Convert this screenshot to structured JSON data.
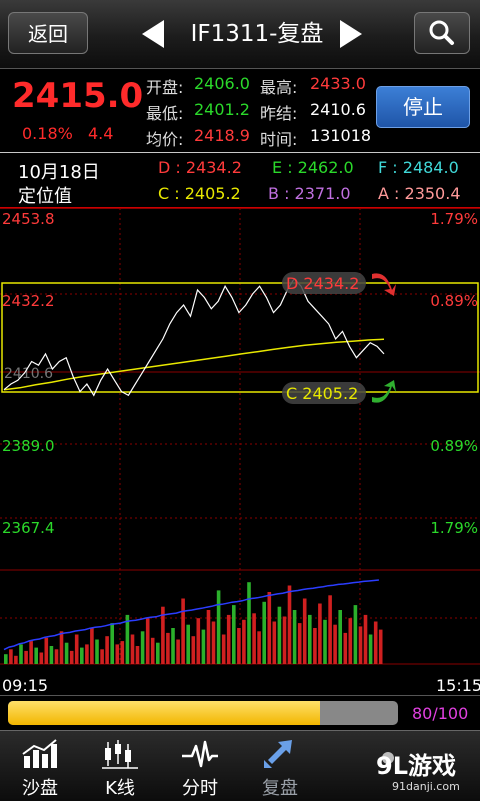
{
  "header": {
    "back_label": "返回",
    "title": "IF1311-复盘"
  },
  "quote": {
    "price": "2415.0",
    "change_pct": "0.18%",
    "change": "4.4",
    "open_label": "开盘:",
    "open": "2406.0",
    "high_label": "最高:",
    "high": "2433.0",
    "low_label": "最低:",
    "low": "2401.2",
    "prev_close_label": "昨结:",
    "prev_close": "2410.6",
    "avg_label": "均价:",
    "avg": "2418.9",
    "time_label": "时间:",
    "time": "131018",
    "stop_label": "停止"
  },
  "levels": {
    "date": "10月18日",
    "caption": "定位值",
    "D": "D : 2434.2",
    "E": "E : 2462.0",
    "F": "F : 2484.0",
    "C": "C : 2405.2",
    "B": "B : 2371.0",
    "A": "A : 2350.4"
  },
  "chart": {
    "y_labels": [
      "2453.8",
      "2432.2",
      "2389.0",
      "2367.4"
    ],
    "pct_labels": [
      "1.79%",
      "0.89%",
      "0.89%",
      "1.79%"
    ],
    "d_tag": "D 2434.2",
    "c_tag": "C 2405.2",
    "mid_label": "2410.6",
    "time_start": "09:15",
    "time_end": "15:15"
  },
  "chart_data": {
    "type": "line",
    "ylim": [
      2367.4,
      2453.8
    ],
    "series": [
      {
        "values": [
          2405.5,
          2407,
          2408,
          2410,
          2413,
          2412,
          2415,
          2411,
          2413,
          2414,
          2409,
          2405,
          2407,
          2404,
          2408,
          2411,
          2408,
          2405,
          2404,
          2407,
          2410,
          2413,
          2416,
          2419,
          2423,
          2426,
          2428,
          2425,
          2432,
          2430,
          2427,
          2429,
          2433,
          2430,
          2426,
          2428,
          2431,
          2433,
          2430,
          2426,
          2428,
          2432,
          2435,
          2433,
          2429,
          2427,
          2425,
          2423,
          2419,
          2421,
          2417,
          2414,
          2416,
          2418,
          2417,
          2415
        ]
      },
      {
        "values": [
          2405.5,
          2406,
          2406.8,
          2407.5,
          2408.3,
          2409,
          2409.6,
          2410.2,
          2410.8,
          2411.4,
          2412,
          2412.6,
          2413.2,
          2413.8,
          2414.4,
          2415,
          2415.6,
          2416.2,
          2416.8,
          2417.3,
          2417.7,
          2418.1,
          2418.4,
          2418.7,
          2418.9
        ]
      }
    ],
    "volume": [
      6,
      9,
      5,
      12,
      8,
      14,
      10,
      7,
      16,
      11,
      9,
      20,
      13,
      8,
      18,
      10,
      12,
      22,
      15,
      9,
      17,
      25,
      12,
      14,
      30,
      18,
      11,
      20,
      28,
      16,
      13,
      35,
      19,
      22,
      15,
      40,
      24,
      17,
      28,
      21,
      33,
      26,
      45,
      18,
      30,
      36,
      22,
      27,
      50,
      31,
      20,
      38,
      44,
      26,
      35,
      29,
      48,
      33,
      25,
      40,
      30,
      22,
      37,
      27,
      42,
      24,
      33,
      19,
      28,
      36,
      23,
      30,
      18,
      26,
      21
    ]
  },
  "progress": {
    "value": 0.8,
    "label": "80/100"
  },
  "tabs": [
    {
      "label": "沙盘",
      "icon": "chart-bar-icon"
    },
    {
      "label": "K线",
      "icon": "candlestick-icon"
    },
    {
      "label": "分时",
      "icon": "pulse-icon"
    },
    {
      "label": "复盘",
      "icon": "replay-icon"
    }
  ],
  "watermark": {
    "logo": "9L游戏",
    "sub": "91danji.com"
  },
  "colors": {
    "up": "#ff2b2b",
    "down": "#2bd92b",
    "accent": "#2f6cc0",
    "level_box": "#e8e800"
  }
}
